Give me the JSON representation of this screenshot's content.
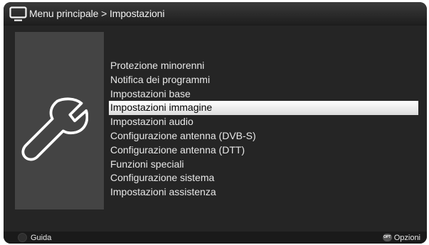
{
  "header": {
    "breadcrumb": "Menu principale > Impostazioni",
    "icon": "tv-icon"
  },
  "side_panel": {
    "icon": "wrench-icon"
  },
  "menu": {
    "items": [
      {
        "label": "Protezione minorenni"
      },
      {
        "label": "Notifica dei programmi"
      },
      {
        "label": "Impostazioni base"
      },
      {
        "label": "Impostazioni immagine",
        "selected": true
      },
      {
        "label": "Impostazioni audio"
      },
      {
        "label": "Configurazione antenna (DVB-S)"
      },
      {
        "label": "Configurazione antenna (DTT)"
      },
      {
        "label": "Funzioni speciali"
      },
      {
        "label": "Configurazione sistema"
      },
      {
        "label": "Impostazioni assistenza"
      }
    ]
  },
  "footer": {
    "guide_label": "Guida",
    "options_icon_text": "OPT",
    "options_label": "Opzioni"
  },
  "colors": {
    "background": "#1c1c1c",
    "panel": "#444444",
    "selection": "#ffffff"
  }
}
